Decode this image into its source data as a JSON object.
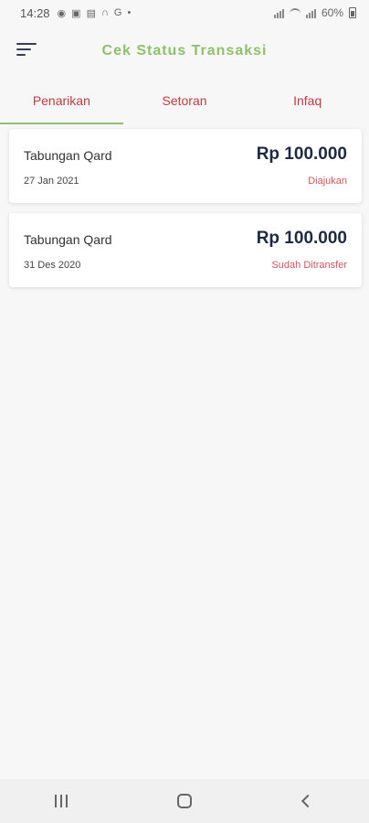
{
  "status_bar": {
    "time": "14:28",
    "battery": "60%"
  },
  "app": {
    "title": "Cek Status Transaksi"
  },
  "tabs": [
    {
      "label": "Penarikan",
      "active": true
    },
    {
      "label": "Setoran",
      "active": false
    },
    {
      "label": "Infaq",
      "active": false
    }
  ],
  "transactions": [
    {
      "title": "Tabungan Qard",
      "date": "27 Jan 2021",
      "amount": "Rp 100.000",
      "status": "Diajukan"
    },
    {
      "title": "Tabungan Qard",
      "date": "31 Des 2020",
      "amount": "Rp 100.000",
      "status": "Sudah Ditransfer"
    }
  ],
  "colors": {
    "accent_green": "#8dc26a",
    "tab_red": "#c23a44",
    "status_red": "#d2555d",
    "amount_navy": "#1e2a44"
  },
  "icons": [
    "menu-icon",
    "recent-apps-icon",
    "home-icon",
    "back-icon"
  ]
}
